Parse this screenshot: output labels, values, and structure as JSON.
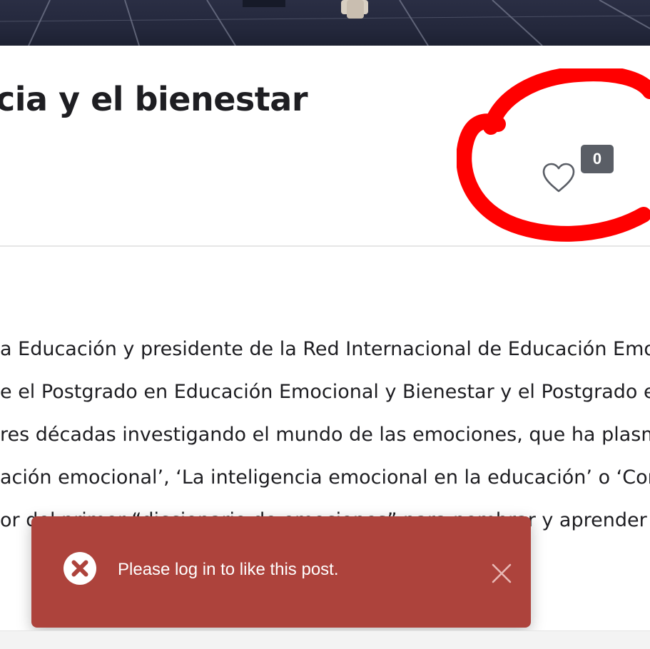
{
  "post": {
    "title": "cia y el bienestar",
    "likes": {
      "count": "0",
      "icon": "heart-outline-icon"
    },
    "body_lines": [
      "a Educación y presidente de la Red Internacional de Educación Emocional",
      "e el Postgrado en Educación Emocional y Bienestar y el Postgrado en Inteligencia",
      "res décadas investigando el mundo de las emociones, que ha plasmado en",
      "ación emocional’, ‘La inteligencia emocional en la educación’ o ‘Competencias",
      "or del primer “diccionario de emociones” para nombrar y aprender a gestionar"
    ]
  },
  "annotation": {
    "shape": "hand-drawn-circle",
    "color": "#ff0000"
  },
  "toast": {
    "message": "Please log in to like this post.",
    "icon": "error-circle-icon",
    "close_icon": "close-icon",
    "background": "#ad433c"
  },
  "colors": {
    "title_text": "#1e1e22",
    "count_badge": "#5a5e66",
    "divider": "#e6e6e6"
  }
}
